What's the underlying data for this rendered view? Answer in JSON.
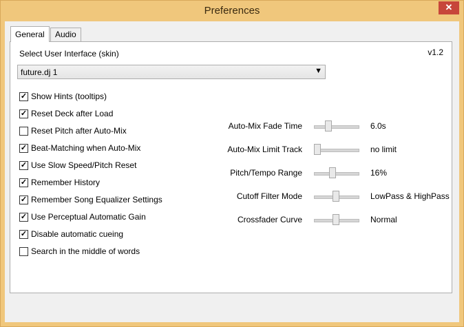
{
  "window": {
    "title": "Preferences"
  },
  "tabs": [
    {
      "label": "General",
      "active": true
    },
    {
      "label": "Audio",
      "active": false
    }
  ],
  "general": {
    "skin_label": "Select User Interface (skin)",
    "version": "v1.2",
    "skin_value": "future.dj 1",
    "checkboxes": [
      {
        "label": "Show Hints (tooltips)",
        "checked": true
      },
      {
        "label": "Reset Deck after Load",
        "checked": true
      },
      {
        "label": "Reset Pitch after Auto-Mix",
        "checked": false
      },
      {
        "label": "Beat-Matching when Auto-Mix",
        "checked": true
      },
      {
        "label": "Use Slow Speed/Pitch Reset",
        "checked": true
      },
      {
        "label": "Remember History",
        "checked": true
      },
      {
        "label": "Remember Song Equalizer Settings",
        "checked": true
      },
      {
        "label": "Use Perceptual Automatic Gain",
        "checked": true
      },
      {
        "label": "Disable automatic cueing",
        "checked": true
      },
      {
        "label": "Search in the middle of words",
        "checked": false
      }
    ],
    "sliders": [
      {
        "label": "Auto-Mix Fade Time",
        "value": "6.0s",
        "level": 0.3
      },
      {
        "label": "Auto-Mix Limit Track",
        "value": "no limit",
        "level": 0.0
      },
      {
        "label": "Pitch/Tempo Range",
        "value": "16%",
        "level": 0.4
      },
      {
        "label": "Cutoff Filter Mode",
        "value": "LowPass & HighPass",
        "level": 0.5
      },
      {
        "label": "Crossfader Curve",
        "value": "Normal",
        "level": 0.5
      }
    ]
  }
}
